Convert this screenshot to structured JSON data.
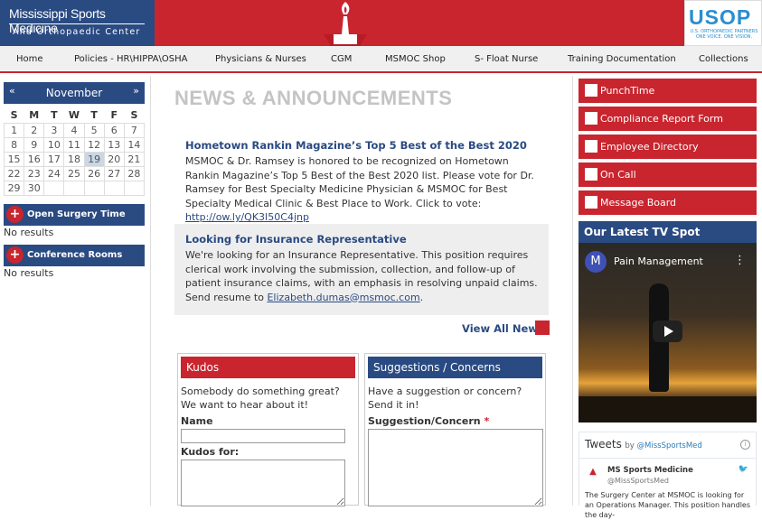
{
  "header": {
    "logo_line1": "Mississippi Sports Medicine",
    "logo_line2": "And Orthopaedic Center",
    "partner_logo": "USOP",
    "partner_tagline": "U.S. ORTHOPAEDIC PARTNERS ONE VOICE. ONE VISION."
  },
  "nav": [
    "Home",
    "Policies - HR\\HIPPA\\OSHA",
    "Physicians & Nurses",
    "CGM",
    "MSMOC Shop",
    "S- Float Nurse",
    "Training Documentation",
    "Collections"
  ],
  "calendar": {
    "month": "November",
    "prev": "«",
    "next": "»",
    "weekdays": [
      "S",
      "M",
      "T",
      "W",
      "T",
      "F",
      "S"
    ],
    "weeks": [
      [
        "1",
        "2",
        "3",
        "4",
        "5",
        "6",
        "7"
      ],
      [
        "8",
        "9",
        "10",
        "11",
        "12",
        "13",
        "14"
      ],
      [
        "15",
        "16",
        "17",
        "18",
        "19",
        "20",
        "21"
      ],
      [
        "22",
        "23",
        "24",
        "25",
        "26",
        "27",
        "28"
      ],
      [
        "29",
        "30",
        "",
        "",
        "",
        "",
        ""
      ]
    ],
    "today": "19"
  },
  "widgets": {
    "surgery_title": "Open Surgery Time",
    "surgery_result": "No results",
    "conference_title": "Conference Rooms",
    "conference_result": "No results"
  },
  "main": {
    "heading": "NEWS & ANNOUNCEMENTS",
    "news": [
      {
        "title": "Hometown Rankin Magazine’s Top 5 Best of the Best 2020",
        "body": "MSMOC & Dr. Ramsey is honored to be recognized on Hometown Rankin Magazine’s Top 5 Best of the Best 2020 list. Please vote for Dr. Ramsey for Best Specialty Medicine Physician & MSMOC for Best Specialty Medical Clinic & Best Place to Work. Click to vote: ",
        "link": "http://ow.ly/QK3I50C4jnp"
      },
      {
        "title": "Looking for Insurance Representative",
        "body": "We're looking for an Insurance Representative. This position requires clerical work involving the submission, collection, and follow-up of patient insurance claims, with an emphasis in resolving unpaid claims. Send resume to ",
        "link": "Elizabeth.dumas@msmoc.com",
        "tail": "."
      }
    ],
    "view_all": "View All News"
  },
  "kudos": {
    "title": "Kudos",
    "desc": "Somebody do something great? We want to hear about it!",
    "name_label": "Name",
    "kudos_label": "Kudos for:"
  },
  "suggestions": {
    "title": "Suggestions / Concerns",
    "desc": "Have a suggestion or concern? Send it in!",
    "field_label": "Suggestion/Concern",
    "required": "*"
  },
  "quick_links": [
    "PunchTime",
    "Compliance Report Form",
    "Employee Directory",
    "On Call",
    "Message Board"
  ],
  "tv": {
    "heading": "Our Latest TV Spot",
    "avatar_letter": "M",
    "video_title": "Pain Management"
  },
  "tweets": {
    "title": "Tweets",
    "by_prefix": "by",
    "handle_link": "@MissSportsMed",
    "account_name": "MS Sports Medicine",
    "account_handle": "@MissSportsMed",
    "text": "The Surgery Center at MSMOC is looking for an Operations Manager. This position handles the day-"
  },
  "colors": {
    "brand_red": "#c8252f",
    "brand_navy": "#2a4a82"
  }
}
